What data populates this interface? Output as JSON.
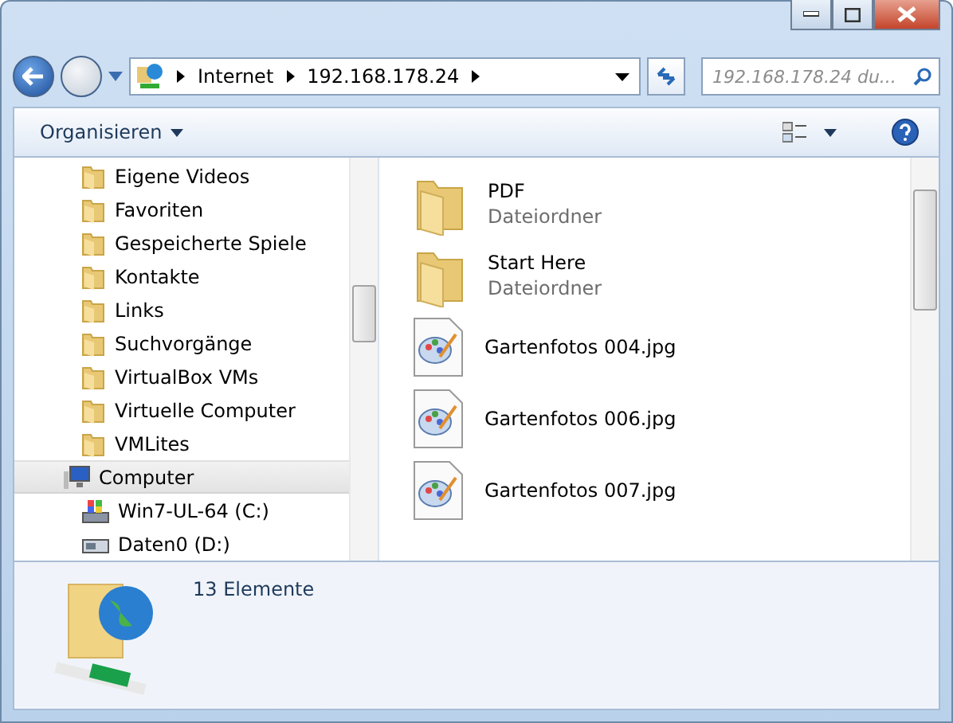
{
  "address_bar": {
    "crumbs": [
      "Internet",
      "192.168.178.24"
    ]
  },
  "search": {
    "placeholder": "192.168.178.24 du..."
  },
  "toolbar": {
    "organize": "Organisieren"
  },
  "nav_pane": {
    "items": [
      {
        "label": "Eigene Videos",
        "kind": "folder",
        "selected": false
      },
      {
        "label": "Favoriten",
        "kind": "folder",
        "selected": false
      },
      {
        "label": "Gespeicherte Spiele",
        "kind": "folder",
        "selected": false
      },
      {
        "label": "Kontakte",
        "kind": "folder",
        "selected": false
      },
      {
        "label": "Links",
        "kind": "folder",
        "selected": false
      },
      {
        "label": "Suchvorgänge",
        "kind": "folder",
        "selected": false
      },
      {
        "label": "VirtualBox VMs",
        "kind": "folder",
        "selected": false
      },
      {
        "label": "Virtuelle Computer",
        "kind": "folder",
        "selected": false
      },
      {
        "label": "VMLites",
        "kind": "folder",
        "selected": false
      },
      {
        "label": "Computer",
        "kind": "computer",
        "selected": true,
        "children": [
          {
            "label": "Win7-UL-64 (C:)",
            "kind": "system-drive",
            "selected": false
          },
          {
            "label": "Daten0 (D:)",
            "kind": "drive",
            "selected": false
          }
        ]
      }
    ]
  },
  "files": [
    {
      "name": "PDF",
      "type": "Dateiordner",
      "kind": "folder"
    },
    {
      "name": "Start Here",
      "type": "Dateiordner",
      "kind": "folder"
    },
    {
      "name": "Gartenfotos 004.jpg",
      "kind": "image"
    },
    {
      "name": "Gartenfotos 006.jpg",
      "kind": "image"
    },
    {
      "name": "Gartenfotos 007.jpg",
      "kind": "image"
    }
  ],
  "details_pane": {
    "count": "13 Elemente"
  }
}
